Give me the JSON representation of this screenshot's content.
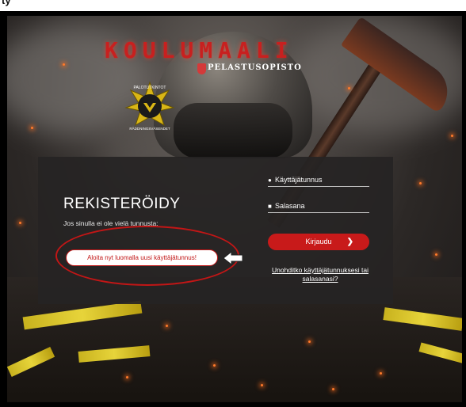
{
  "top_fragment": "ty",
  "header": {
    "title": "KOULUMAALI",
    "school_name": "PELASTUSOPISTO",
    "badge_top_text": "PALOTUTKINTOT",
    "badge_bottom_text": "RÄDDNINGSVÄSENDET"
  },
  "register": {
    "title": "REKISTERÖIDY",
    "subtitle": "Jos sinulla ei ole vielä tunnusta:",
    "cta_label": "Aloita nyt luomalla uusi käyttäjätunnus!"
  },
  "login": {
    "username_label": "Käyttäjätunnus",
    "password_label": "Salasana",
    "submit_label": "Kirjaudu",
    "submit_icon": "chevron-right-icon",
    "forgot_label": "Unohditko käyttäjätunnuksesi tai salasanasi?"
  },
  "colors": {
    "accent_red": "#c81a1a",
    "panel_bg": "#262423",
    "annotation_red": "#c21616"
  }
}
